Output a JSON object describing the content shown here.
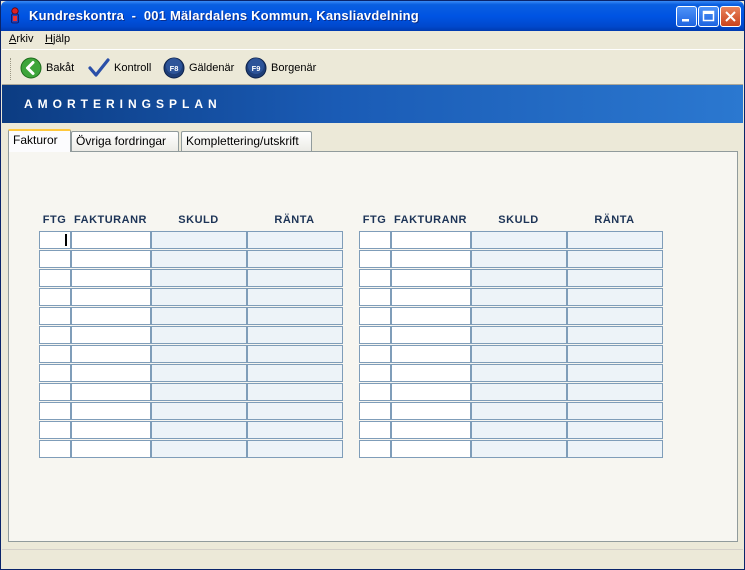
{
  "window": {
    "title": "Kundreskontra  -  001 Mälardalens Kommun, Kansliavdelning"
  },
  "menu": [
    {
      "label": "Arkiv",
      "underline": "A"
    },
    {
      "label": "Hjälp",
      "underline": "H"
    }
  ],
  "toolbar": {
    "back_label": "Bakåt",
    "control_label": "Kontroll",
    "debtor_label": "Gäldenär",
    "debtor_key": "F8",
    "creditor_label": "Borgenär",
    "creditor_key": "F9"
  },
  "banner": {
    "title": "AMORTERINGSPLAN"
  },
  "tabs": [
    {
      "label": "Fakturor",
      "active": true
    },
    {
      "label": "Övriga fordringar",
      "active": false
    },
    {
      "label": "Komplettering/utskrift",
      "active": false
    }
  ],
  "table": {
    "columns": [
      "FTG",
      "FAKTURANR",
      "SKULD",
      "RÄNTA"
    ],
    "row_count": 12
  },
  "colors": {
    "title_bar": "#0054E3",
    "banner": "#1A5BB5",
    "header_text": "#1D3457",
    "cell_border": "#7F9DB9",
    "editable_cell": "#FFFFFF",
    "readonly_cell": "#EDF3F8"
  }
}
